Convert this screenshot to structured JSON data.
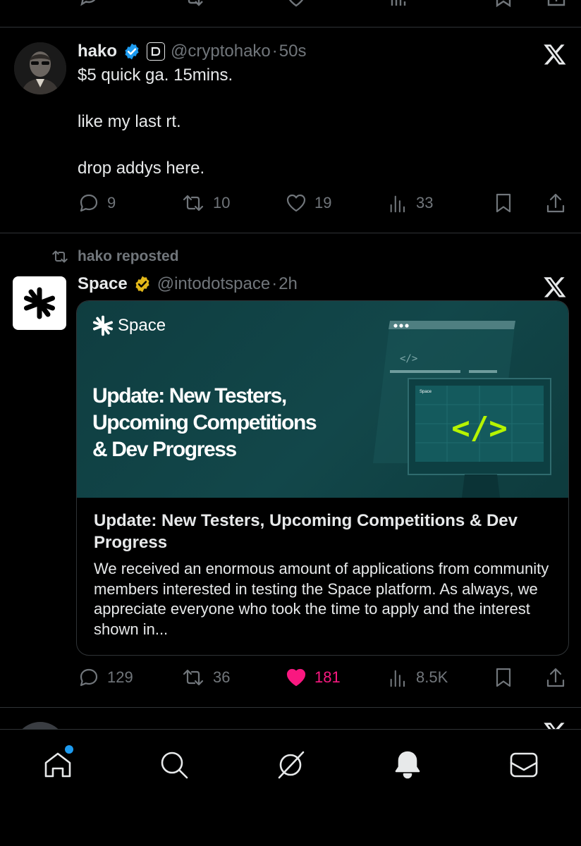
{
  "tweet1": {
    "name": "hako",
    "handle": "@cryptohako",
    "time": "50s",
    "lines": [
      "$5 quick ga. 15mins.",
      "like my last rt.",
      "drop addys here."
    ],
    "replies": "9",
    "reposts": "10",
    "likes": "19",
    "views": "33"
  },
  "repost_notice": "hako reposted",
  "tweet2": {
    "name": "Space",
    "handle": "@intodotspace",
    "time": "2h",
    "card": {
      "brand": "Space",
      "image_headline_lines": [
        "Update: New Testers,",
        "Upcoming Competitions",
        "& Dev Progress"
      ],
      "mini_brand": "Space",
      "code_symbol": "</>",
      "title": "Update: New Testers, Upcoming Competitions & Dev Progress",
      "description": "We received an enormous amount of applications from community members interested in testing the Space platform. As always, we appreciate everyone who took the time to apply and the interest shown in..."
    },
    "replies": "129",
    "reposts": "36",
    "likes": "181",
    "views": "8.5K"
  },
  "colors": {
    "like_active": "#f91880",
    "verified_blue": "#1d9bf0",
    "verified_gold": "#e2b719",
    "card_teal": "#12474a",
    "code_green": "#b6f400"
  }
}
